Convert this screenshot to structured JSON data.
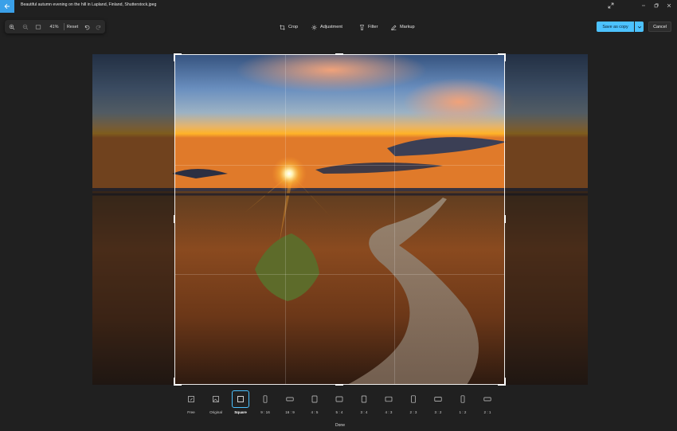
{
  "window": {
    "title": "Beautiful autumn evening on the hill in Lapland, Finland, Shutterstock.jpeg"
  },
  "zoom_bar": {
    "zoom_level": "41%",
    "reset_label": "Reset"
  },
  "tabs": [
    {
      "label": "Crop",
      "icon": "crop-icon"
    },
    {
      "label": "Adjustment",
      "icon": "sun-icon"
    },
    {
      "label": "Filter",
      "icon": "filter-icon"
    },
    {
      "label": "Markup",
      "icon": "pen-icon"
    }
  ],
  "actions": {
    "save_label": "Save as copy",
    "cancel_label": "Cancel"
  },
  "aspect_ratios": [
    {
      "label": "Free",
      "icon": "free-crop-icon"
    },
    {
      "label": "Original",
      "icon": "image-icon"
    },
    {
      "label": "Square",
      "selected": true
    },
    {
      "label": "9 : 16"
    },
    {
      "label": "16 : 9"
    },
    {
      "label": "4 : 5"
    },
    {
      "label": "5 : 4"
    },
    {
      "label": "3 : 4"
    },
    {
      "label": "4 : 3"
    },
    {
      "label": "2 : 3"
    },
    {
      "label": "3 : 2"
    },
    {
      "label": "1 : 2"
    },
    {
      "label": "2 : 1"
    }
  ],
  "done_label": "Done",
  "colors": {
    "accent": "#4cc2ff",
    "background": "#202020",
    "back_button": "#3aa0e8"
  }
}
